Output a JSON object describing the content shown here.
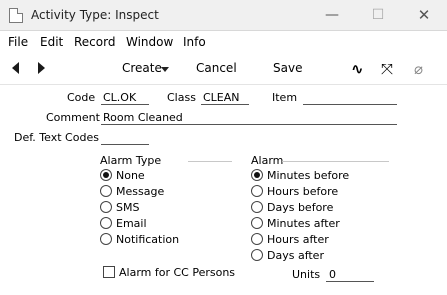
{
  "window": {
    "title": "Activity Type: Inspect",
    "minimize_glyph": "—",
    "maximize_glyph": "☐",
    "close_glyph": "✕"
  },
  "menu": [
    "File",
    "Edit",
    "Record",
    "Window",
    "Info"
  ],
  "toolbar": {
    "create_label": "Create",
    "cancel_label": "Cancel",
    "save_label": "Save",
    "icons": [
      "prev-record-icon",
      "next-record-icon",
      "spell-check-icon",
      "expand-icon",
      "attachment-icon"
    ],
    "spell_glyph": "∿",
    "expand_glyph": "⤧",
    "attach_glyph": "⌀"
  },
  "form": {
    "code_label": "Code",
    "code_value": "CL.OK",
    "class_label": "Class",
    "class_value": "CLEAN",
    "item_label": "Item",
    "item_value": "",
    "comment_label": "Comment",
    "comment_value": "Room Cleaned",
    "def_text_label": "Def. Text Codes",
    "def_text_value": ""
  },
  "alarm_type": {
    "title": "Alarm Type",
    "options": [
      "None",
      "Message",
      "SMS",
      "Email",
      "Notification"
    ],
    "selected": "None"
  },
  "alarm": {
    "title": "Alarm",
    "options": [
      "Minutes before",
      "Hours before",
      "Days before",
      "Minutes after",
      "Hours after",
      "Days after"
    ],
    "selected": "Minutes before"
  },
  "cc_checkbox": {
    "label": "Alarm for CC Persons",
    "checked": false
  },
  "units": {
    "label": "Units",
    "value": "0"
  }
}
